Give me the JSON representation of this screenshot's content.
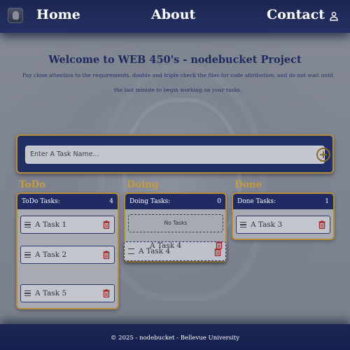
{
  "nav": {
    "home": "Home",
    "about": "About",
    "contact": "Contact"
  },
  "welcome": {
    "title": "Welcome to WEB 450's - nodebucket Project",
    "text": "Pay close attention to the requirements, double and triple check the files for code attribution, and do not wait until the last minute to begin working on your tasks."
  },
  "task_input": {
    "placeholder": "Enter A Task Name..."
  },
  "columns": {
    "todo": {
      "heading": "ToDo",
      "header_label": "ToDo Tasks:",
      "count": "4",
      "tasks": [
        "A Task 1",
        "A Task 2",
        "A Task 5"
      ]
    },
    "doing": {
      "heading": "Doing",
      "header_label": "Doing Tasks:",
      "count": "0",
      "empty_text": "No Tasks"
    },
    "done": {
      "heading": "Done",
      "header_label": "Done Tasks:",
      "count": "1",
      "tasks": [
        "A Task 3"
      ]
    }
  },
  "dragging": {
    "label": "A Task 4"
  },
  "footer": {
    "text": "© 2025 - nodebucket - Bellevue University"
  },
  "colors": {
    "navy": "#1f2b62",
    "gold": "#b58c3a",
    "delete_red": "#a3262a"
  },
  "icons": {
    "user": "person-icon",
    "add": "plus-circle-icon",
    "drag": "drag-handle-icon",
    "delete": "trash-icon"
  }
}
